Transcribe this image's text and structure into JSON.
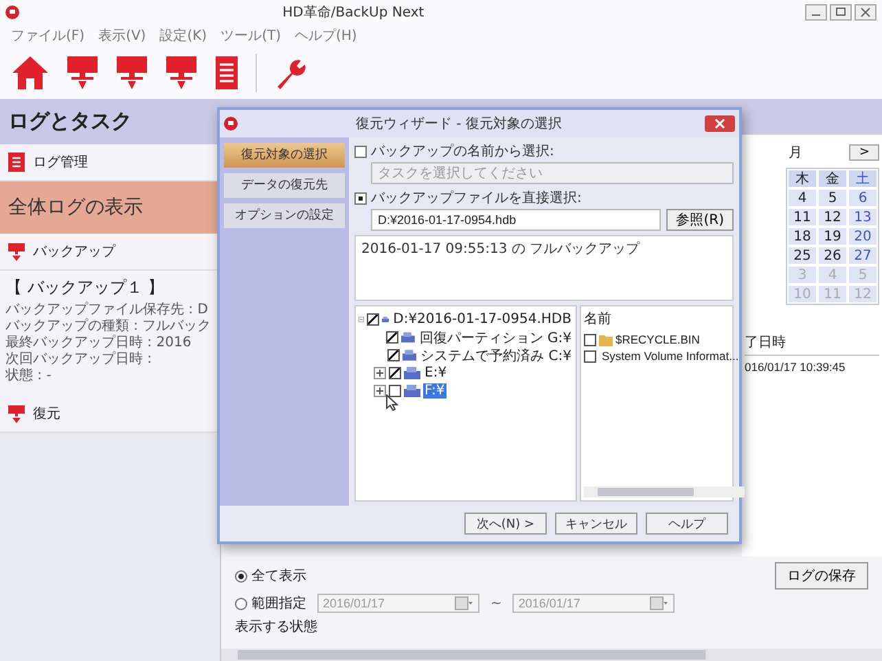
{
  "window": {
    "title": "HD革命/BackUp Next"
  },
  "menu": [
    "ファイル(F)",
    "表示(V)",
    "設定(K)",
    "ツール(T)",
    "ヘルプ(H)"
  ],
  "sidebar": {
    "title": "ログとタスク",
    "sections": [
      {
        "label": "ログ管理",
        "items": [
          {
            "label": "全体ログの表示",
            "selected": true
          }
        ]
      },
      {
        "label": "バックアップ",
        "task": {
          "name": "【 バックアップ１ 】",
          "details": [
            "バックアップファイル保存先 : D",
            "バックアップの種類 : フルバック",
            "最終バックアップ日時 : 2016",
            "次回バックアップ日時 :",
            "状態 : -"
          ]
        }
      },
      {
        "label": "復元"
      }
    ]
  },
  "calendar": {
    "month": "月",
    "next": ">",
    "weekdays": [
      "木",
      "金",
      "土"
    ],
    "weeks": [
      {
        "days": [
          "4",
          "5",
          "6"
        ],
        "other_month": false
      },
      {
        "days": [
          "11",
          "12",
          "13"
        ],
        "other_month": false
      },
      {
        "days": [
          "18",
          "19",
          "20"
        ],
        "other_month": false
      },
      {
        "days": [
          "25",
          "26",
          "27"
        ],
        "other_month": false
      },
      {
        "days": [
          "3",
          "4",
          "5"
        ],
        "other_month": true
      },
      {
        "days": [
          "10",
          "11",
          "12"
        ],
        "other_month": true
      }
    ]
  },
  "log_table": {
    "columns": [
      "了日時"
    ],
    "rows": [
      [
        "016/01/17 10:39:45"
      ]
    ]
  },
  "filter": {
    "options": [
      {
        "label": "全て表示",
        "selected": true
      },
      {
        "label": "範囲指定",
        "selected": false
      }
    ],
    "from": "2016/01/17",
    "separator": "~",
    "to": "2016/01/17",
    "disabled": true,
    "status_label": "表示する状態",
    "save_button": "ログの保存"
  },
  "dialog": {
    "title": "復元ウィザード - 復元対象の選択",
    "steps": [
      {
        "label": "復元対象の選択",
        "selected": true
      },
      {
        "label": "データの復元先",
        "selected": false
      },
      {
        "label": "オプションの設定",
        "selected": false
      }
    ],
    "source_options": [
      {
        "label": "バックアップの名前から選択:",
        "selected": false,
        "field": {
          "placeholder": "タスクを選択してください",
          "disabled": true
        }
      },
      {
        "label": "バックアップファイルを直接選択:",
        "selected": true,
        "field": {
          "value": "D:¥2016-01-17-0954.hdb",
          "disabled": false
        },
        "button": "参照(R)"
      }
    ],
    "description": "2016-01-17 09:55:13 の フルバックアップ",
    "tree": [
      {
        "label": "D:¥2016-01-17-0954.HDB",
        "checked": true,
        "selected": false,
        "expanded": true,
        "children": [
          {
            "label": "回復パーティション G:¥",
            "checked": true,
            "selected": false
          },
          {
            "label": "システムで予約済み C:¥",
            "checked": true,
            "selected": false
          },
          {
            "label": "E:¥",
            "checked": true,
            "selected": false,
            "expanded": false
          },
          {
            "label": "F:¥",
            "checked": false,
            "selected": true,
            "expanded": false
          }
        ]
      }
    ],
    "files": {
      "columns": [
        "名前"
      ],
      "rows": [
        {
          "name": "$RECYCLE.BIN",
          "checked": false
        },
        {
          "name": "System Volume Informat...",
          "checked": false
        }
      ]
    },
    "buttons": [
      "次へ(N) >",
      "キャンセル",
      "ヘルプ"
    ]
  }
}
